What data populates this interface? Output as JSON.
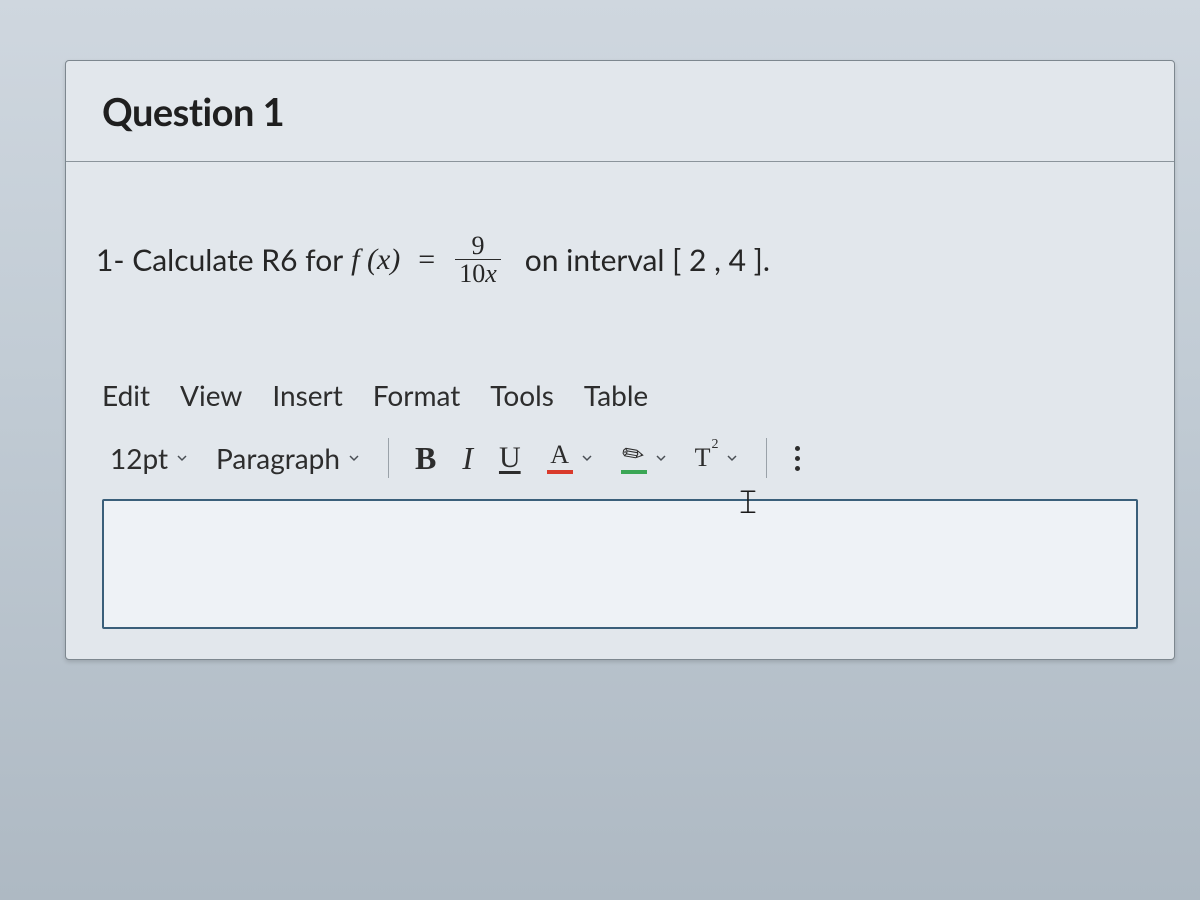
{
  "question": {
    "title": "Question 1",
    "prompt_prefix": "1- Calculate R6 for",
    "fn_lhs": "f (x)",
    "equals": "=",
    "fraction": {
      "num": "9",
      "den_10": "10",
      "den_x": "x"
    },
    "prompt_suffix": "on interval [ 2 , 4 ]."
  },
  "editor": {
    "menus": [
      "Edit",
      "View",
      "Insert",
      "Format",
      "Tools",
      "Table"
    ],
    "font_size_label": "12pt",
    "block_label": "Paragraph",
    "bold_label": "B",
    "italic_label": "I",
    "underline_label": "U",
    "text_color_glyph": "A",
    "highlight_glyph": "✎",
    "super_label": "T",
    "super_exp": "2",
    "answer_text": ""
  },
  "cursor_glyph": "𝙸"
}
